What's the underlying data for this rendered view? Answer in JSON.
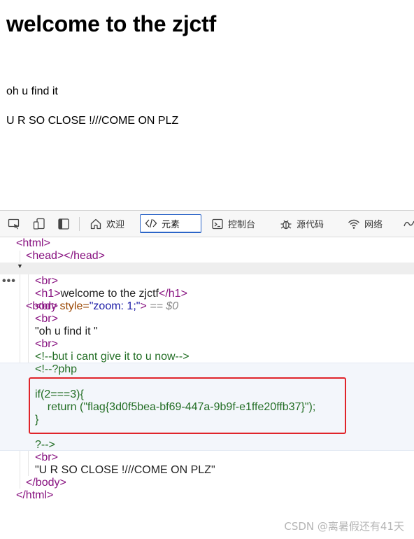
{
  "page": {
    "heading": "welcome to the zjctf",
    "para1": "oh u find it",
    "para2": "U R SO CLOSE !///COME ON PLZ"
  },
  "devtools": {
    "tabs": [
      {
        "label": "欢迎",
        "icon": "home-icon"
      },
      {
        "label": "元素",
        "icon": "code-icon"
      },
      {
        "label": "控制台",
        "icon": "console-icon"
      },
      {
        "label": "源代码",
        "icon": "bug-icon"
      },
      {
        "label": "网络",
        "icon": "wifi-icon"
      }
    ],
    "active_tab": "元素"
  },
  "dom": {
    "html_open": "<html>",
    "head": "<head></head>",
    "body_open_tag": "<body ",
    "body_attr": "style=",
    "body_val": "\"zoom: 1;\"",
    "body_close_bracket": ">",
    "body_marker": " == $0",
    "br": "<br>",
    "h1_open": "<h1>",
    "h1_text": "welcome to the zjctf",
    "h1_close": "</h1>",
    "text_node_1": "\"oh u find it \"",
    "comment_1": "<!--but i cant give it to u now-->",
    "comment_php_open": "<!--?php",
    "php_line_1": "if(2===3){",
    "php_line_2": "    return (\"flag{3d0f5bea-bf69-447a-9b9f-e1ffe20ffb37}\");",
    "php_line_3": "}",
    "comment_php_close": "?-->",
    "text_node_2": "\"U R SO CLOSE !///COME ON PLZ\"",
    "body_close": "</body>",
    "html_close": "</html>",
    "ellipsis": "•••"
  },
  "watermark": "CSDN @离暑假还有41天",
  "colors": {
    "tag": "#881280",
    "attr": "#994500",
    "value": "#1a1aa6",
    "comment": "#236e25",
    "highlight_box": "#e0242a",
    "active_tab_border": "#2b65c8"
  }
}
